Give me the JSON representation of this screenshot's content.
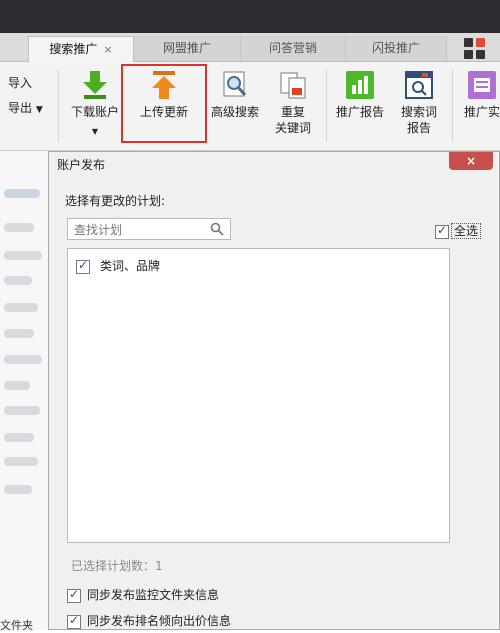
{
  "tabs": [
    {
      "label": "搜索推广",
      "close": "×"
    },
    {
      "label": "网盟推广"
    },
    {
      "label": "问答营销"
    },
    {
      "label": "闪投推广"
    }
  ],
  "toolbar": {
    "import_label": "导入",
    "export_label": "导出",
    "download_label": "下载账户",
    "upload_label": "上传更新",
    "advanced_search_label": "高级搜索",
    "duplicate_keywords_line1": "重复",
    "duplicate_keywords_line2": "关键词",
    "report_label": "推广报告",
    "search_term_line1": "搜索词",
    "search_term_line2": "报告",
    "promo_practice_label": "推广实",
    "colors": {
      "download": "#4caf22",
      "upload": "#f08a1c",
      "report": "#4cb82a",
      "purple": "#b06fd6",
      "highlight": "#e0302a"
    }
  },
  "left_pane": {
    "bottom_text": "文件夹"
  },
  "dialog": {
    "title": "账户发布",
    "close_label": "×",
    "select_label": "选择有更改的计划:",
    "search_placeholder": "查找计划",
    "select_all_label": "全选",
    "items": [
      {
        "label": "类词、品牌",
        "checked": true
      }
    ],
    "selected_count_text": "已选择计划数：1",
    "options": [
      {
        "label": "同步发布监控文件夹信息",
        "checked": true
      },
      {
        "label": "同步发布排名倾向出价信息",
        "checked": true
      }
    ]
  }
}
